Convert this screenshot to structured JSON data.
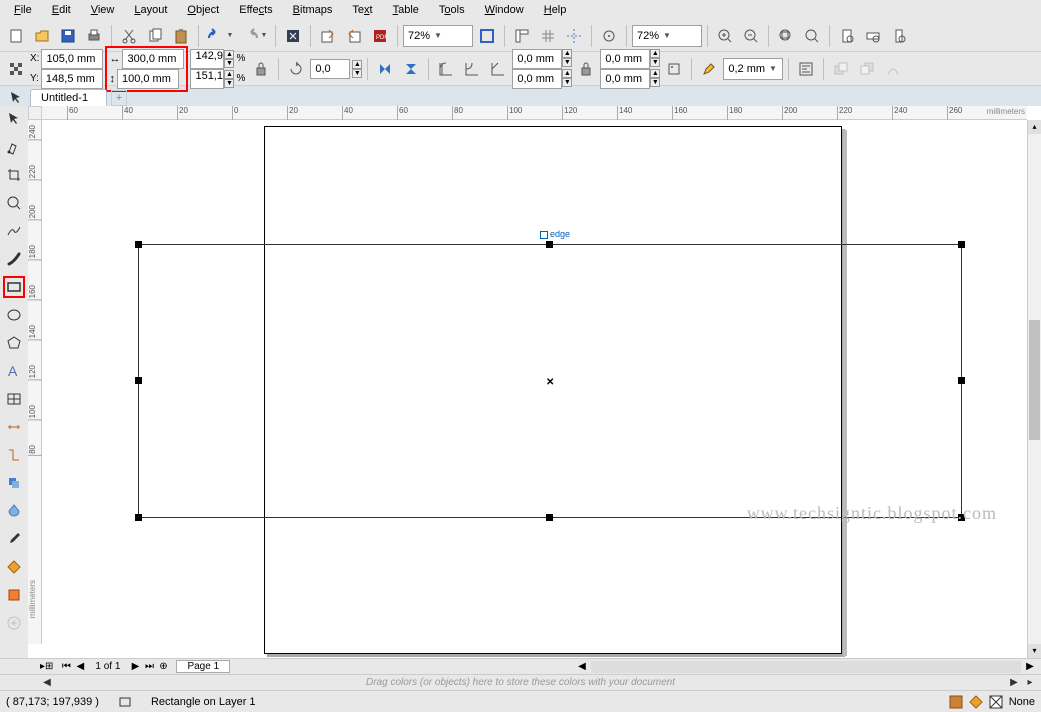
{
  "menu": [
    "File",
    "Edit",
    "View",
    "Layout",
    "Object",
    "Effects",
    "Bitmaps",
    "Text",
    "Table",
    "Tools",
    "Window",
    "Help"
  ],
  "toolbar1": {
    "zoom_combo": "72%",
    "zoom_combo2": "72%"
  },
  "propbar": {
    "x_label": "X:",
    "y_label": "Y:",
    "x_val": "105,0 mm",
    "y_val": "148,5 mm",
    "w_val": "300,0 mm",
    "h_val": "100,0 mm",
    "scale_x": "142,9",
    "scale_y": "151,1",
    "pct": "%",
    "angle": "0,0",
    "size1": "0,0 mm",
    "size2": "0,0 mm",
    "size3": "0,0 mm",
    "size4": "0,0 mm",
    "outline": "0,2 mm"
  },
  "doc": {
    "tab": "Untitled-1"
  },
  "ruler_h": [
    {
      "pos": 25,
      "label": "60"
    },
    {
      "pos": 80,
      "label": "40"
    },
    {
      "pos": 135,
      "label": "20"
    },
    {
      "pos": 190,
      "label": "0"
    },
    {
      "pos": 245,
      "label": "20"
    },
    {
      "pos": 300,
      "label": "40"
    },
    {
      "pos": 355,
      "label": "60"
    },
    {
      "pos": 410,
      "label": "80"
    },
    {
      "pos": 465,
      "label": "100"
    },
    {
      "pos": 520,
      "label": "120"
    },
    {
      "pos": 575,
      "label": "140"
    },
    {
      "pos": 630,
      "label": "160"
    },
    {
      "pos": 685,
      "label": "180"
    },
    {
      "pos": 740,
      "label": "200"
    },
    {
      "pos": 795,
      "label": "220"
    },
    {
      "pos": 850,
      "label": "240"
    },
    {
      "pos": 905,
      "label": "260"
    }
  ],
  "ruler_h_unit": "millimeters",
  "ruler_v": [
    {
      "pos": 5,
      "label": "240"
    },
    {
      "pos": 45,
      "label": "220"
    },
    {
      "pos": 85,
      "label": "200"
    },
    {
      "pos": 125,
      "label": "180"
    },
    {
      "pos": 165,
      "label": "160"
    },
    {
      "pos": 205,
      "label": "140"
    },
    {
      "pos": 245,
      "label": "120"
    },
    {
      "pos": 285,
      "label": "100"
    },
    {
      "pos": 325,
      "label": "80"
    }
  ],
  "ruler_v_unit": "millimeters",
  "edge_label": "edge",
  "nav": {
    "pages": "1 of 1",
    "page_tab": "Page 1"
  },
  "tray_hint": "Drag colors (or objects) here to store these colors with your document",
  "status": {
    "coords": "( 87,173; 197,939 )",
    "object": "Rectangle on Layer 1",
    "fill": "None"
  },
  "watermark": "www.techsigntic.blogspot.com"
}
